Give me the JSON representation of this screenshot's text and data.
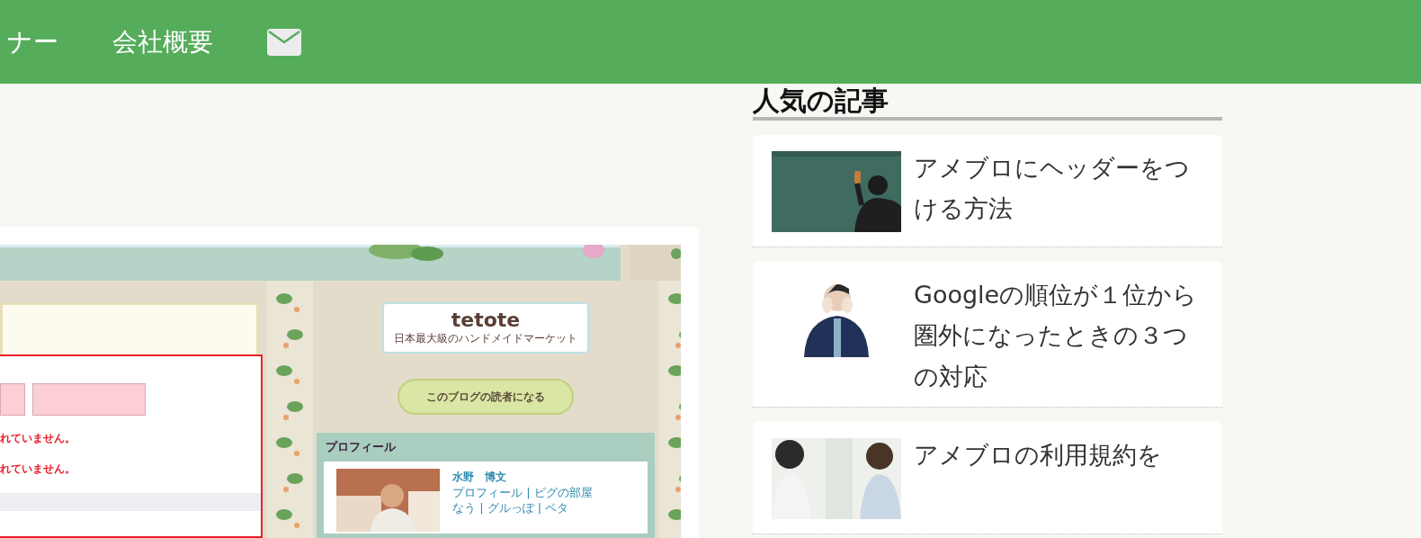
{
  "nav": {
    "items": [
      {
        "label": "ナー"
      },
      {
        "label": "会社概要"
      }
    ]
  },
  "article": {
    "screenshot": {
      "logo": {
        "name": "tetote",
        "tagline": "日本最大級のハンドメイドマーケット"
      },
      "errors": [
        "れていません。",
        "れていません。"
      ],
      "reader_button": "このブログの読者になる",
      "profile": {
        "title": "プロフィール",
        "name": "水野　博文",
        "link_lines": [
          "プロフィール | ピグの部屋",
          "なう | グルっぽ | ペタ"
        ]
      }
    }
  },
  "sidebar": {
    "title": "人気の記事",
    "articles": [
      {
        "title": "アメブロにヘッダーをつける方法",
        "kind": "chalkboard"
      },
      {
        "title": "Googleの順位が１位から圏外になったときの３つの対応",
        "kind": "suit"
      },
      {
        "title": "アメブロの利用規約を",
        "kind": "pair"
      }
    ]
  }
}
